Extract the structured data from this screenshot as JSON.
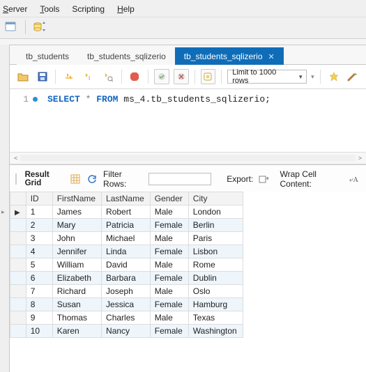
{
  "menu": {
    "server": "Server",
    "tools": "Tools",
    "scripting": "Scripting",
    "help": "Help"
  },
  "tabs": [
    {
      "label": "tb_students"
    },
    {
      "label": "tb_students_sqlizerio"
    },
    {
      "label": "tb_students_sqlizerio"
    }
  ],
  "limit_label": "Limit to 1000 rows",
  "sql": {
    "line_no": "1",
    "kw1": "SELECT",
    "star": "*",
    "kw2": "FROM",
    "ident": "ms_4.tb_students_sqlizerio;"
  },
  "results_bar": {
    "grid_label": "Result Grid",
    "filter_label": "Filter Rows:",
    "filter_value": "",
    "export_label": "Export:",
    "wrap_label": "Wrap Cell Content:"
  },
  "columns": {
    "c1": "ID",
    "c2": "FirstName",
    "c3": "LastName",
    "c4": "Gender",
    "c5": "City"
  },
  "rows": [
    {
      "id": "1",
      "fn": "James",
      "ln": "Robert",
      "g": "Male",
      "city": "London"
    },
    {
      "id": "2",
      "fn": "Mary",
      "ln": "Patricia",
      "g": "Female",
      "city": "Berlin"
    },
    {
      "id": "3",
      "fn": "John",
      "ln": "Michael",
      "g": "Male",
      "city": "Paris"
    },
    {
      "id": "4",
      "fn": "Jennifer",
      "ln": "Linda",
      "g": "Female",
      "city": "Lisbon"
    },
    {
      "id": "5",
      "fn": "William",
      "ln": "David",
      "g": "Male",
      "city": "Rome"
    },
    {
      "id": "6",
      "fn": "Elizabeth",
      "ln": "Barbara",
      "g": "Female",
      "city": "Dublin"
    },
    {
      "id": "7",
      "fn": "Richard",
      "ln": "Joseph",
      "g": "Male",
      "city": "Oslo"
    },
    {
      "id": "8",
      "fn": "Susan",
      "ln": "Jessica",
      "g": "Female",
      "city": "Hamburg"
    },
    {
      "id": "9",
      "fn": "Thomas",
      "ln": "Charles",
      "g": "Male",
      "city": "Texas"
    },
    {
      "id": "10",
      "fn": "Karen",
      "ln": "Nancy",
      "g": "Female",
      "city": "Washington"
    }
  ]
}
